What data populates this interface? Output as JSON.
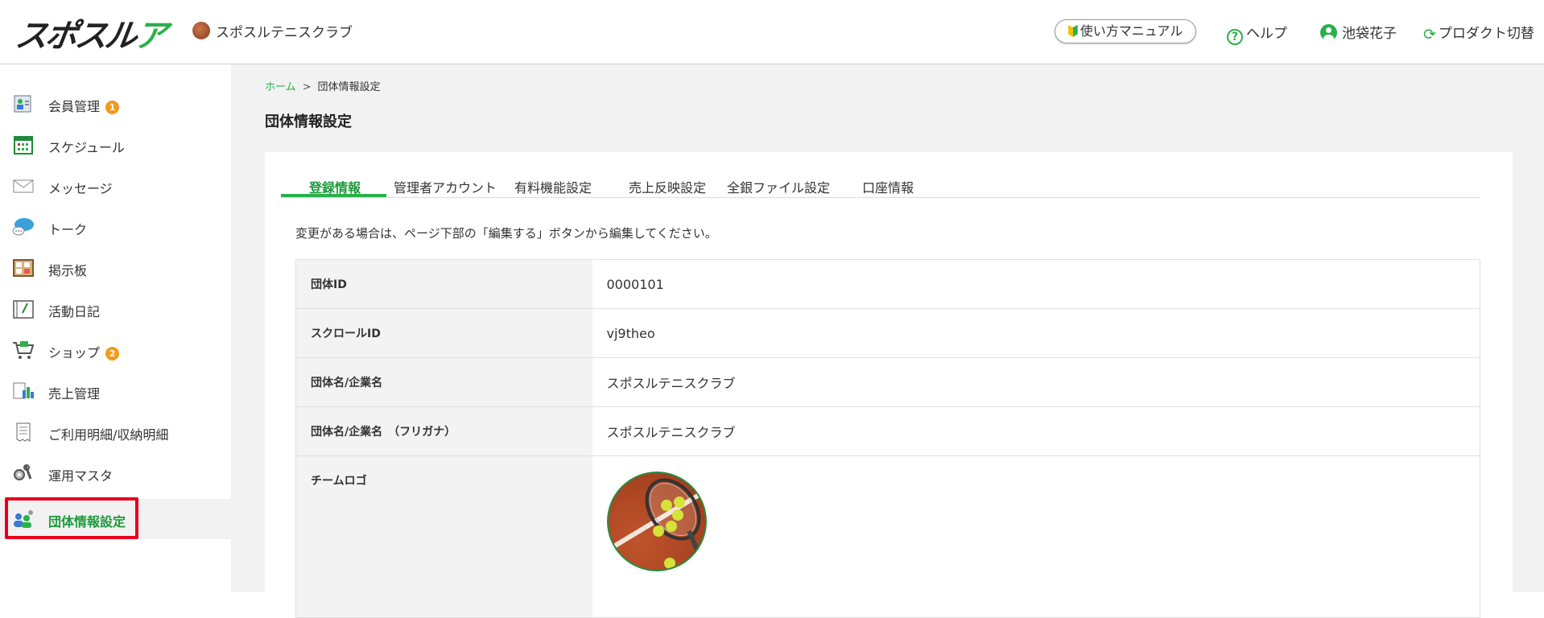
{
  "header": {
    "logo_text_a": "スポスル",
    "logo_text_b": "アプリ",
    "club_name": "スポスルテニスクラブ",
    "manual_label": "使い方マニュアル",
    "help_label": "ヘルプ",
    "user_name": "池袋花子",
    "switch_label": "プロダクト切替"
  },
  "sidebar": {
    "items": [
      {
        "label": "会員管理",
        "badge": "1",
        "icon": "member-card-icon"
      },
      {
        "label": "スケジュール",
        "icon": "calendar-icon"
      },
      {
        "label": "メッセージ",
        "icon": "envelope-icon"
      },
      {
        "label": "トーク",
        "icon": "chat-bubble-icon"
      },
      {
        "label": "掲示板",
        "icon": "bulletin-board-icon"
      },
      {
        "label": "活動日記",
        "icon": "diary-icon"
      },
      {
        "label": "ショップ",
        "badge": "2",
        "icon": "cart-icon"
      },
      {
        "label": "売上管理",
        "icon": "sales-chart-icon"
      },
      {
        "label": "ご利用明細/収納明細",
        "icon": "receipt-icon"
      },
      {
        "label": "運用マスタ",
        "icon": "gears-icon"
      },
      {
        "label": "団体情報設定",
        "icon": "group-settings-icon",
        "active": true
      }
    ]
  },
  "breadcrumb": {
    "home": "ホーム",
    "separator": ">",
    "current": "団体情報設定"
  },
  "page_title": "団体情報設定",
  "tabs": [
    "登録情報",
    "管理者アカウント",
    "有料機能設定",
    "売上反映設定",
    "全銀ファイル設定",
    "口座情報"
  ],
  "notice": "変更がある場合は、ページ下部の「編集する」ボタンから編集してください。",
  "info": {
    "rows": [
      {
        "label": "団体ID",
        "value": "0000101"
      },
      {
        "label": "スクロールID",
        "value": "vj9theo"
      },
      {
        "label": "団体名/企業名",
        "value": "スポスルテニスクラブ"
      },
      {
        "label": "団体名/企業名　（フリガナ）",
        "value": "スポスルテニスクラブ"
      },
      {
        "label": "チームロゴ",
        "value": ""
      }
    ]
  },
  "colors": {
    "accent": "#2bb04a",
    "badge": "#f39a1e",
    "highlight": "#e8001c"
  }
}
